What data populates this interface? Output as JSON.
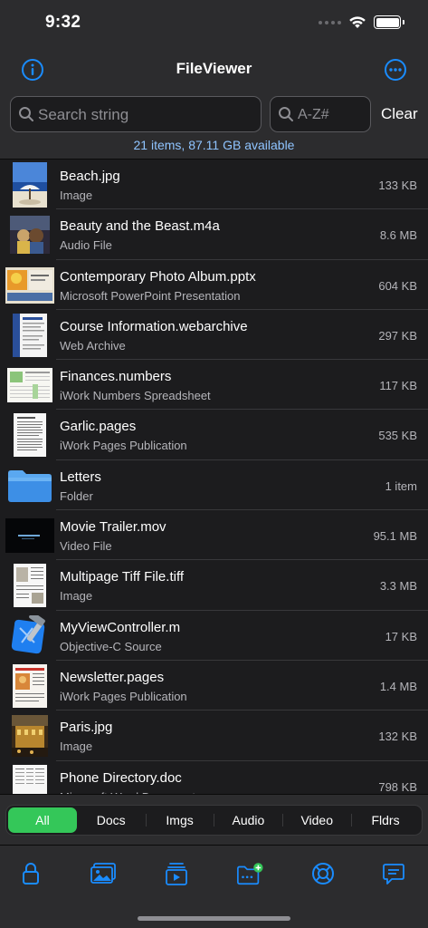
{
  "status": {
    "time": "9:32"
  },
  "nav": {
    "title": "FileViewer",
    "info_icon": "info-icon",
    "more_icon": "ellipsis-icon"
  },
  "search": {
    "placeholder": "Search string",
    "sort_placeholder": "A-Z#",
    "clear_label": "Clear",
    "summary": "21 items, 87.11 GB available"
  },
  "files": [
    {
      "name": "Beach.jpg",
      "kind": "Image",
      "size": "133 KB",
      "thumb": "beach-photo"
    },
    {
      "name": "Beauty and the Beast.m4a",
      "kind": "Audio File",
      "size": "8.6 MB",
      "thumb": "album-art"
    },
    {
      "name": "Contemporary Photo Album.pptx",
      "kind": "Microsoft PowerPoint Presentation",
      "size": "604 KB",
      "thumb": "presentation"
    },
    {
      "name": "Course Information.webarchive",
      "kind": "Web Archive",
      "size": "297 KB",
      "thumb": "web-page"
    },
    {
      "name": "Finances.numbers",
      "kind": "iWork Numbers Spreadsheet",
      "size": "117 KB",
      "thumb": "spreadsheet"
    },
    {
      "name": "Garlic.pages",
      "kind": "iWork Pages Publication",
      "size": "535 KB",
      "thumb": "text-document"
    },
    {
      "name": "Letters",
      "kind": "Folder",
      "size": "1 item",
      "thumb": "folder"
    },
    {
      "name": "Movie Trailer.mov",
      "kind": "Video File",
      "size": "95.1 MB",
      "thumb": "video-frame"
    },
    {
      "name": "Multipage Tiff File.tiff",
      "kind": "Image",
      "size": "3.3 MB",
      "thumb": "tiff-page"
    },
    {
      "name": "MyViewController.m",
      "kind": "Objective-C Source",
      "size": "17 KB",
      "thumb": "xcode"
    },
    {
      "name": "Newsletter.pages",
      "kind": "iWork Pages Publication",
      "size": "1.4 MB",
      "thumb": "newsletter"
    },
    {
      "name": "Paris.jpg",
      "kind": "Image",
      "size": "132 KB",
      "thumb": "paris-photo"
    },
    {
      "name": "Phone Directory.doc",
      "kind": "Microsoft Word Document",
      "size": "798 KB",
      "thumb": "word-doc"
    }
  ],
  "filters": [
    {
      "label": "All",
      "active": true
    },
    {
      "label": "Docs",
      "active": false
    },
    {
      "label": "Imgs",
      "active": false
    },
    {
      "label": "Audio",
      "active": false
    },
    {
      "label": "Video",
      "active": false
    },
    {
      "label": "Fldrs",
      "active": false
    }
  ],
  "tabs": [
    {
      "icon": "lock-icon"
    },
    {
      "icon": "photos-icon"
    },
    {
      "icon": "video-player-icon"
    },
    {
      "icon": "add-folder-icon"
    },
    {
      "icon": "lifebuoy-icon"
    },
    {
      "icon": "chat-bubble-icon"
    }
  ],
  "colors": {
    "accent": "#1a8cff",
    "active_segment": "#34c759",
    "summary_text": "#8fc4ff",
    "background": "#1c1c1e",
    "bar": "#2c2c2e"
  }
}
